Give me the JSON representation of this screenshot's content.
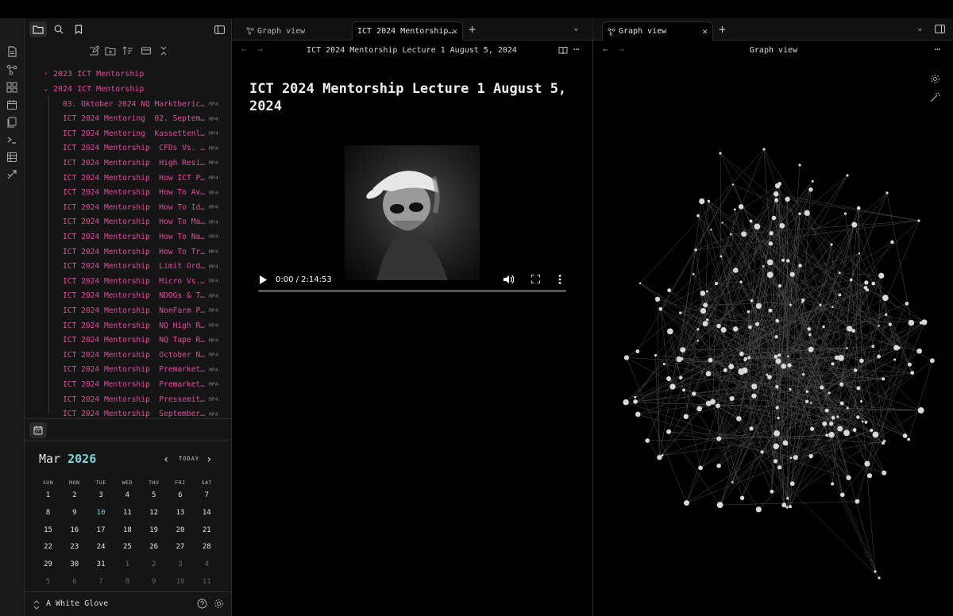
{
  "ribbon": {
    "icons": [
      "new-note-icon",
      "graph-icon",
      "canvas-icon",
      "daily-note-icon",
      "templates-icon",
      "command-palette-icon",
      "bases-icon",
      "publish-icon"
    ]
  },
  "sidebar": {
    "tabs": [
      "files-icon",
      "search-icon",
      "bookmarks-icon"
    ],
    "toolbar": [
      "new-note-icon",
      "new-folder-icon",
      "sort-icon",
      "collapse-icon",
      "close-all-icon"
    ],
    "folders": [
      {
        "label": "2023 ICT Mentorship",
        "expanded": false
      },
      {
        "label": "2024 ICT Mentorship",
        "expanded": true
      }
    ],
    "files": [
      {
        "name": "03. Oktober 2024 NQ Marktbericht",
        "ext": "MP4"
      },
      {
        "name": "ICT 2024 Mentoring  02. Septemb…",
        "ext": "MP4"
      },
      {
        "name": "ICT 2024 Mentoring  Kassettenle…",
        "ext": "MP4"
      },
      {
        "name": "ICT 2024 Mentorship  CFDs Vs. F…",
        "ext": "MP4"
      },
      {
        "name": "ICT 2024 Mentorship  High Resis…",
        "ext": "MP4"
      },
      {
        "name": "ICT 2024 Mentorship  How ICT Pi…",
        "ext": "MP4"
      },
      {
        "name": "ICT 2024 Mentorship  How To Avo…",
        "ext": "MP4"
      },
      {
        "name": "ICT 2024 Mentorship  How To Ide…",
        "ext": "MP4"
      },
      {
        "name": "ICT 2024 Mentorship  How To Man…",
        "ext": "MP4"
      },
      {
        "name": "ICT 2024 Mentorship  How To Nav…",
        "ext": "MP4"
      },
      {
        "name": "ICT 2024 Mentorship  How To Tra…",
        "ext": "MP4"
      },
      {
        "name": "ICT 2024 Mentorship  Limit Orde…",
        "ext": "MP4"
      },
      {
        "name": "ICT 2024 Mentorship  Micro Vs. …",
        "ext": "MP4"
      },
      {
        "name": "ICT 2024 Mentorship  NDOGs & Ta…",
        "ext": "MP4"
      },
      {
        "name": "ICT 2024 Mentorship  NonFarm Pa…",
        "ext": "MP4"
      },
      {
        "name": "ICT 2024 Mentorship  NQ High Re…",
        "ext": "MP4"
      },
      {
        "name": "ICT 2024 Mentorship  NQ Tape Re…",
        "ext": "MP4"
      },
      {
        "name": "ICT 2024 Mentorship  October NF…",
        "ext": "MP4"
      },
      {
        "name": "ICT 2024 Mentorship  Premarket …",
        "ext": "MP4"
      },
      {
        "name": "ICT 2024 Mentorship  Premarket …",
        "ext": "MP4"
      },
      {
        "name": "ICT 2024 Mentorship  Pressemitt…",
        "ext": "MP4"
      },
      {
        "name": "ICT 2024 Mentorship  September …",
        "ext": "MP4"
      }
    ]
  },
  "calendar": {
    "tab_icon": "calendar-icon",
    "month": "Mar",
    "year": "2026",
    "today_label": "TODAY",
    "prev_icon": "chevron-left-icon",
    "next_icon": "chevron-right-icon",
    "weekdays": [
      "SUN",
      "MON",
      "TUE",
      "WED",
      "THU",
      "FRI",
      "SAT"
    ],
    "weeks": [
      [
        "1",
        "2",
        "3",
        "4",
        "5",
        "6",
        "7"
      ],
      [
        "8",
        "9",
        "10",
        "11",
        "12",
        "13",
        "14"
      ],
      [
        "15",
        "16",
        "17",
        "18",
        "19",
        "20",
        "21"
      ],
      [
        "22",
        "23",
        "24",
        "25",
        "26",
        "27",
        "28"
      ],
      [
        "29",
        "30",
        "31",
        "1",
        "2",
        "3",
        "4"
      ],
      [
        "5",
        "6",
        "7",
        "8",
        "9",
        "10",
        "11"
      ]
    ],
    "today": "10",
    "other_month_from_week": 4,
    "other_month_from_col": 3
  },
  "vault": {
    "name": "A White Glove",
    "help_icon": "help-icon",
    "settings_icon": "gear-icon"
  },
  "center": {
    "tabs": [
      {
        "label": "Graph view",
        "icon": "graph-icon",
        "active": false
      },
      {
        "label": "ICT 2024 Mentorship…",
        "active": true
      }
    ],
    "view_title": "ICT 2024 Mentorship Lecture 1 August 5, 2024",
    "note_title": "ICT 2024 Mentorship Lecture 1 August 5, 2024",
    "video": {
      "time": "0:00 / 2:14:53",
      "progress": 0
    }
  },
  "right": {
    "tabs": [
      {
        "label": "Graph view",
        "icon": "graph-icon",
        "active": true
      }
    ],
    "view_title": "Graph view",
    "graph_controls": [
      "gear-icon",
      "magic-wand-icon"
    ]
  },
  "colors": {
    "accent_pink": "#e04d9c",
    "accent_cyan": "#7ad3d8",
    "background": "#000000",
    "sidebar_bg": "#151515"
  }
}
